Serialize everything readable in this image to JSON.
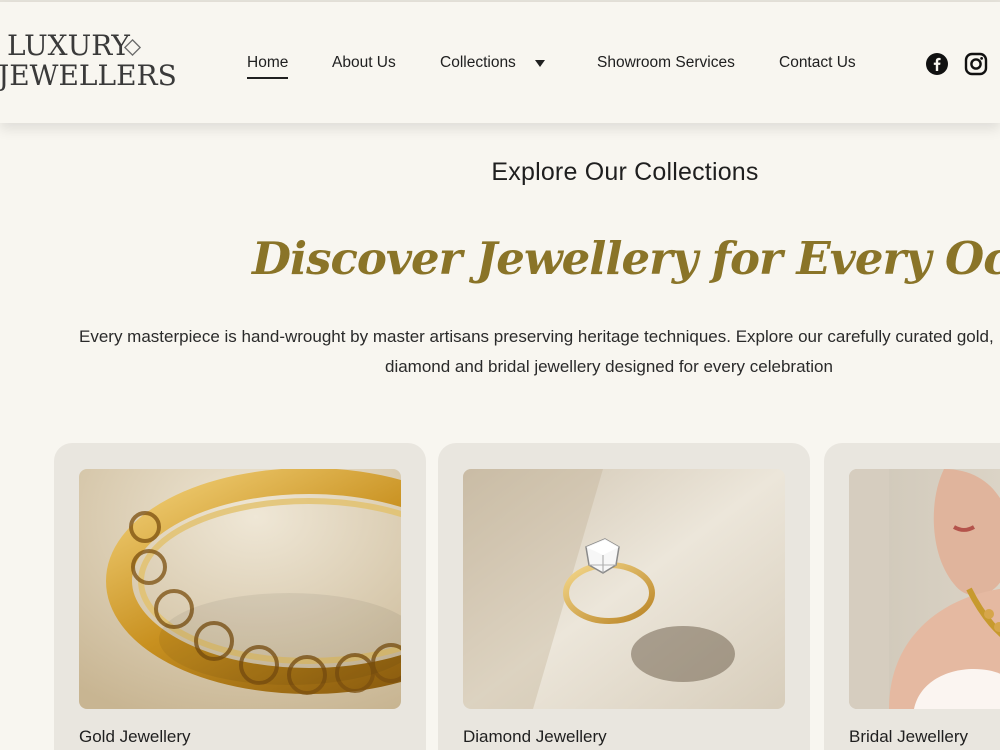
{
  "brand": {
    "line1": "LUXURY",
    "line2": "JEWELLERS"
  },
  "nav": {
    "items": [
      {
        "label": "Home"
      },
      {
        "label": "About Us"
      },
      {
        "label": "Collections"
      },
      {
        "label": "Showroom Services"
      },
      {
        "label": "Contact Us"
      }
    ],
    "active": "Home"
  },
  "social": {
    "facebook_icon": "facebook-icon",
    "instagram_icon": "instagram-icon"
  },
  "hero": {
    "kicker": "Explore Our Collections",
    "headline": "Discover Jewellery for Every Occasion",
    "intro_line1": "Every masterpiece is hand-wrought by master artisans preserving heritage techniques. Explore our carefully curated gold,",
    "intro_line2": "diamond and bridal jewellery designed for every celebration"
  },
  "collections": [
    {
      "title": "Gold Jewellery"
    },
    {
      "title": "Diamond Jewellery"
    },
    {
      "title": "Bridal Jewellery"
    }
  ],
  "colors": {
    "background": "#f8f6f0",
    "accent_gold": "#8a7428",
    "card_bg": "#e9e6df",
    "text": "#1f1f1f"
  }
}
